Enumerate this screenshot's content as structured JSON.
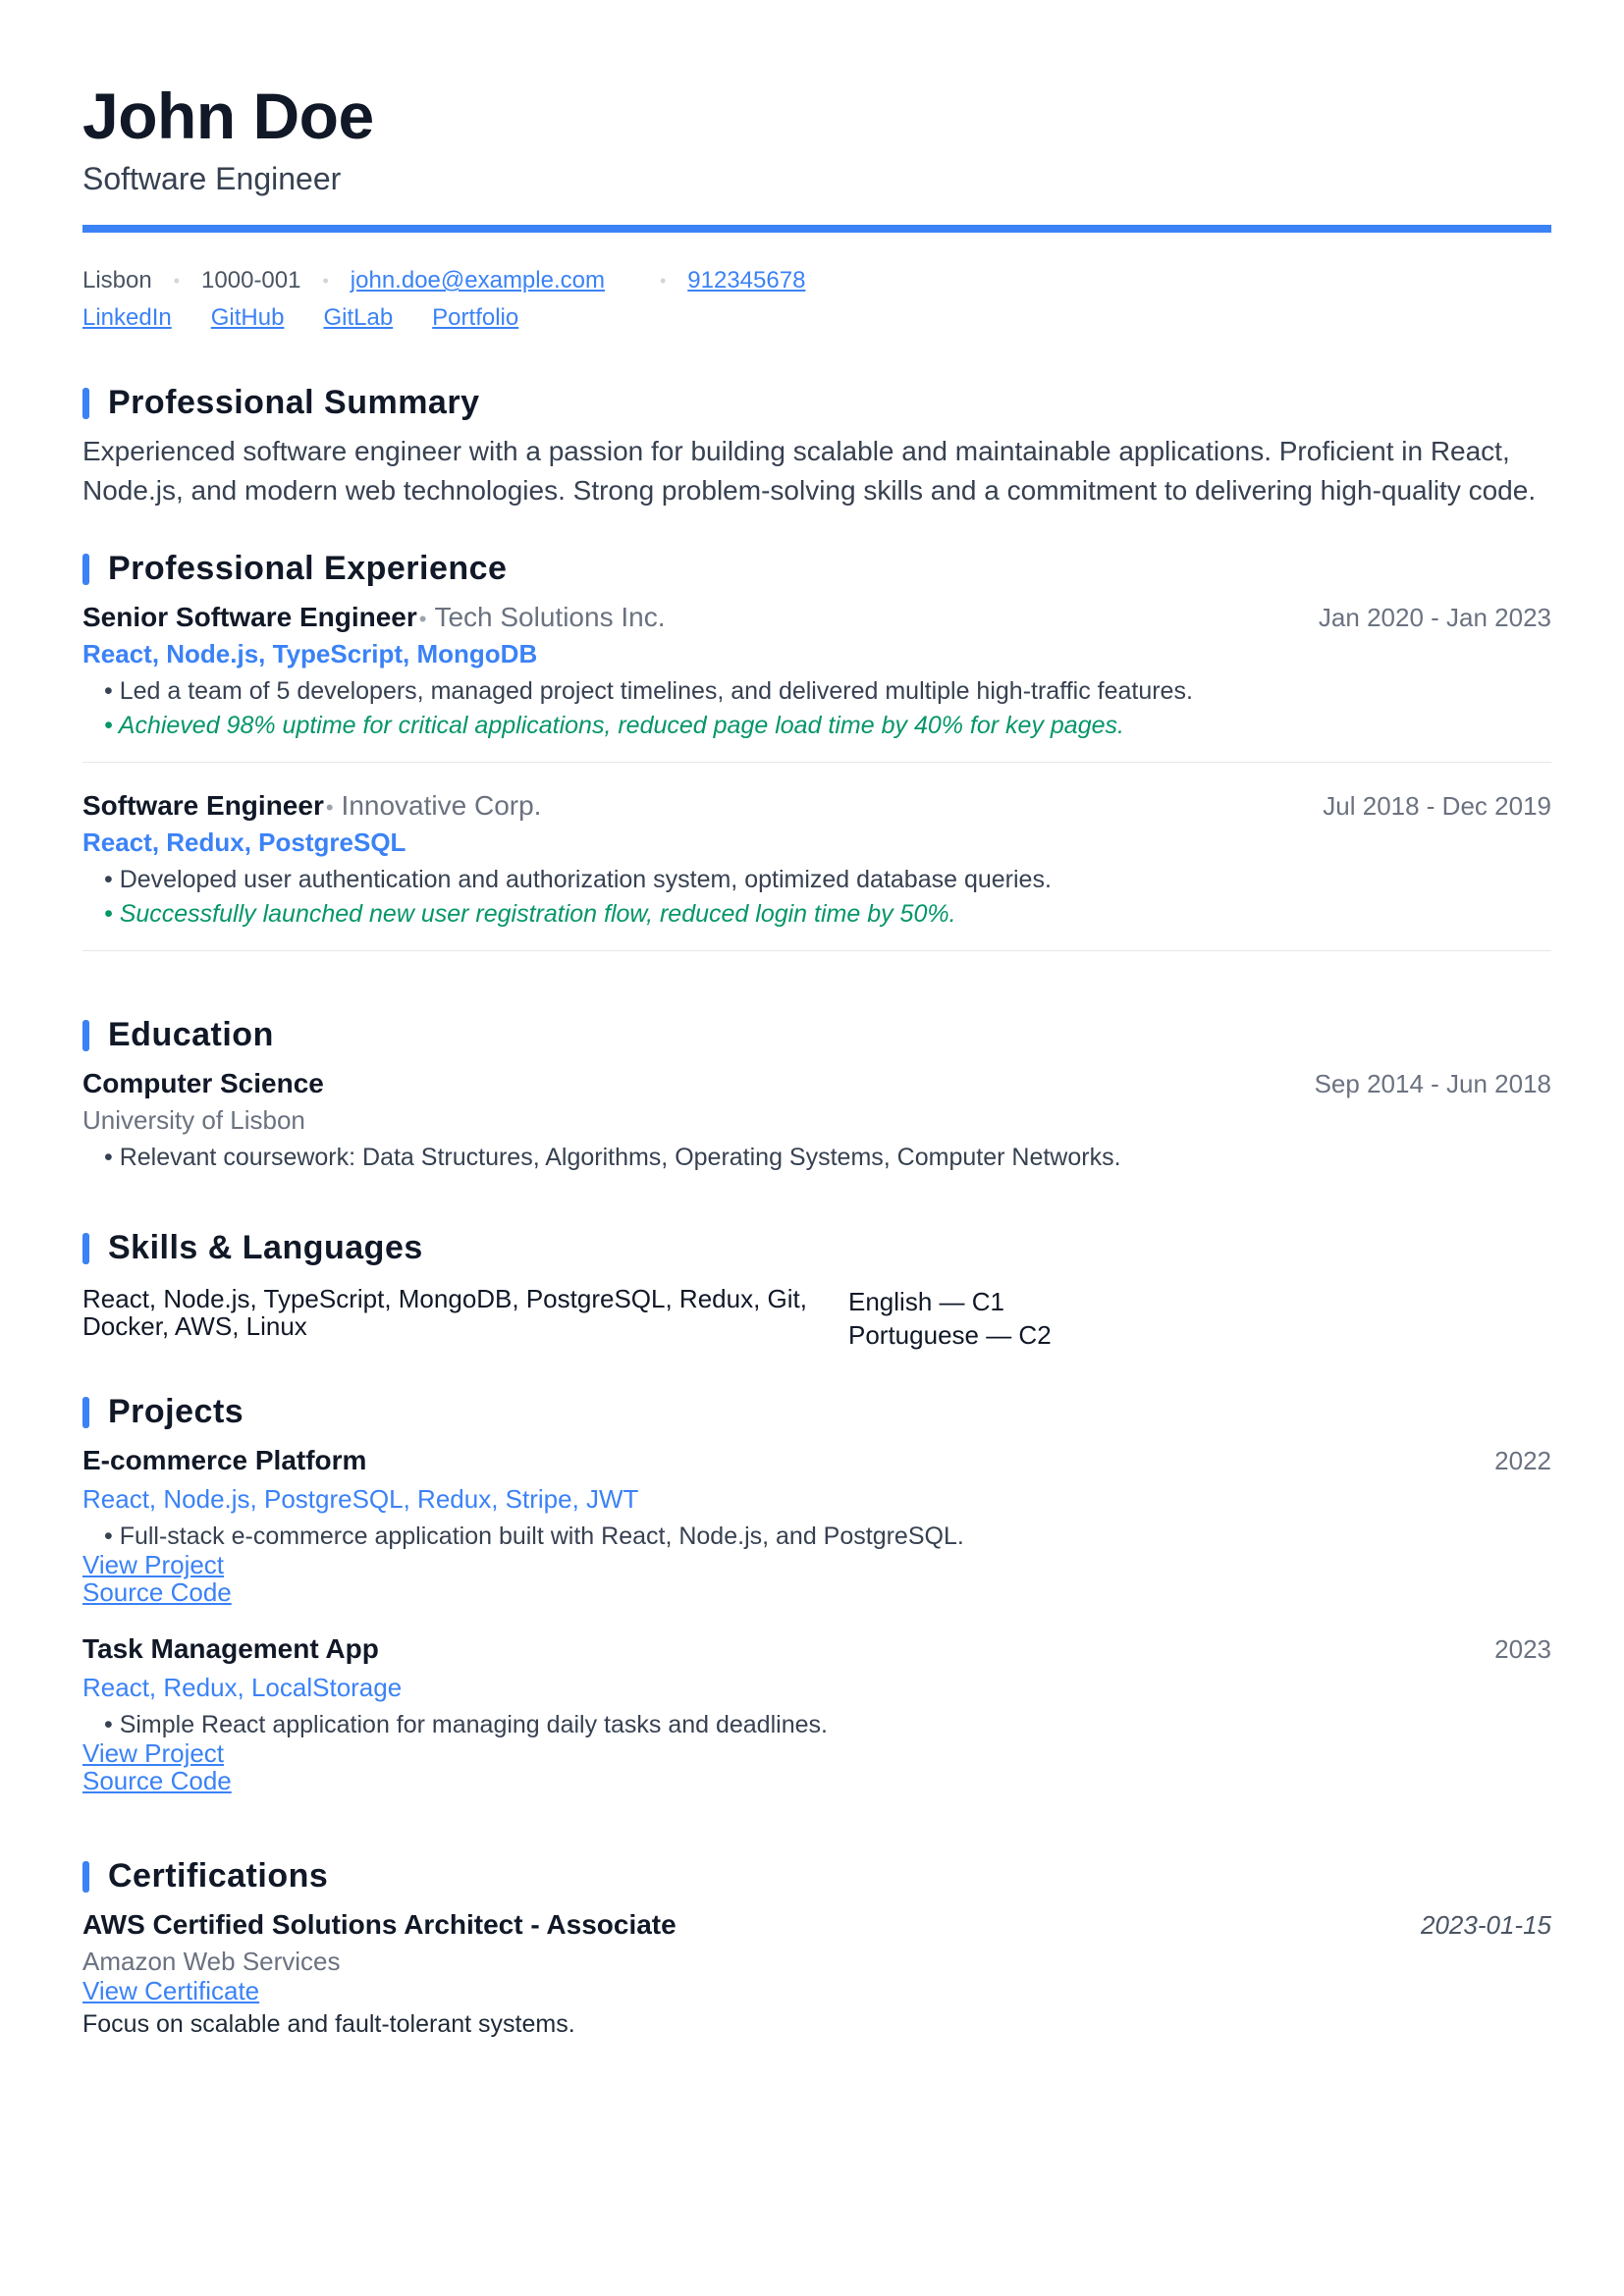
{
  "header": {
    "name": "John Doe",
    "title": "Software Engineer",
    "accent_color": "#3b82f6"
  },
  "contact": {
    "city": "Lisbon",
    "postal": "1000-001",
    "email": "john.doe@example.com",
    "phone": "912345678",
    "links": [
      "LinkedIn",
      "GitHub",
      "GitLab",
      "Portfolio"
    ]
  },
  "sections": {
    "summary": "Professional Summary",
    "experience": "Professional Experience",
    "education": "Education",
    "skills": "Skills & Languages",
    "projects": "Projects",
    "certifications": "Certifications"
  },
  "summary": "Experienced software engineer with a passion for building scalable and maintainable applications. Proficient in React, Node.js, and modern web technologies. Strong problem-solving skills and a commitment to delivering high-quality code.",
  "experience": [
    {
      "role": "Senior Software Engineer",
      "company": "Tech Solutions Inc.",
      "dates": "Jan 2020 - Jan 2023",
      "tech": "React, Node.js, TypeScript, MongoDB",
      "bullet": "• Led a team of 5 developers, managed project timelines, and delivered multiple high-traffic features.",
      "achievement": "• Achieved 98% uptime for critical applications, reduced page load time by 40% for key pages."
    },
    {
      "role": "Software Engineer",
      "company": "Innovative Corp.",
      "dates": "Jul 2018 - Dec 2019",
      "tech": "React, Redux, PostgreSQL",
      "bullet": "• Developed user authentication and authorization system, optimized database queries.",
      "achievement": "• Successfully launched new user registration flow, reduced login time by 50%."
    }
  ],
  "education": {
    "degree": "Computer Science",
    "school": "University of Lisbon",
    "dates": "Sep 2014 - Jun 2018",
    "bullet": "• Relevant coursework: Data Structures, Algorithms, Operating Systems, Computer Networks."
  },
  "skills": {
    "line1": "React, Node.js, TypeScript, MongoDB, PostgreSQL, Redux, Git,",
    "line2": "Docker, AWS, Linux",
    "languages": [
      "English — C1",
      "Portuguese — C2"
    ]
  },
  "projects": [
    {
      "name": "E-commerce Platform",
      "year": "2022",
      "tech": "React, Node.js, PostgreSQL, Redux, Stripe, JWT",
      "bullet": "• Full-stack e-commerce application built with React, Node.js, and PostgreSQL.",
      "view": "View Project",
      "source": "Source Code"
    },
    {
      "name": "Task Management App",
      "year": "2023",
      "tech": "React, Redux, LocalStorage",
      "bullet": "• Simple React application for managing daily tasks and deadlines.",
      "view": "View Project",
      "source": "Source Code"
    }
  ],
  "certification": {
    "name": "AWS Certified Solutions Architect - Associate",
    "issuer": "Amazon Web Services",
    "date": "2023-01-15",
    "link": "View Certificate",
    "note": "Focus on scalable and fault-tolerant systems."
  }
}
